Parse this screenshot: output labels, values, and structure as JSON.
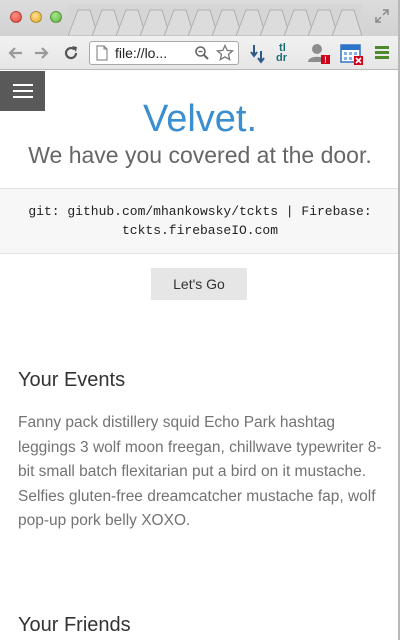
{
  "browser": {
    "url_text": "file://lo...",
    "tldr_label": "tl\ndr",
    "icons": {
      "back": "arrow-left-icon",
      "forward": "arrow-right-icon",
      "reload": "reload-icon",
      "page": "page-icon",
      "zoom": "zoom-icon",
      "bookmark": "star-icon",
      "pocket": "pocket-icon",
      "tldr": "tldr-icon",
      "person": "person-icon",
      "calendar": "calendar-icon",
      "menu": "menu-icon",
      "fullscreen": "fullscreen-icon"
    }
  },
  "page": {
    "brand": "Velvet.",
    "tagline": "We have you covered at the door.",
    "info_line1": "git: github.com/mhankowsky/tckts | Firebase:",
    "info_line2": "tckts.firebaseIO.com",
    "go_button": "Let's Go",
    "events_title": "Your Events",
    "events_body": "Fanny pack distillery squid Echo Park hashtag leggings 3 wolf moon freegan, chillwave typewriter 8-bit small batch flexitarian put a bird on it mustache. Selfies gluten-free dreamcatcher mustache fap, wolf pop-up pork belly XOXO.",
    "friends_title": "Your Friends"
  },
  "colors": {
    "brand": "#3b8ed0",
    "hamburger_bg": "#595959",
    "button_bg": "#e6e6e6",
    "info_band_bg": "#f7f7f7"
  }
}
